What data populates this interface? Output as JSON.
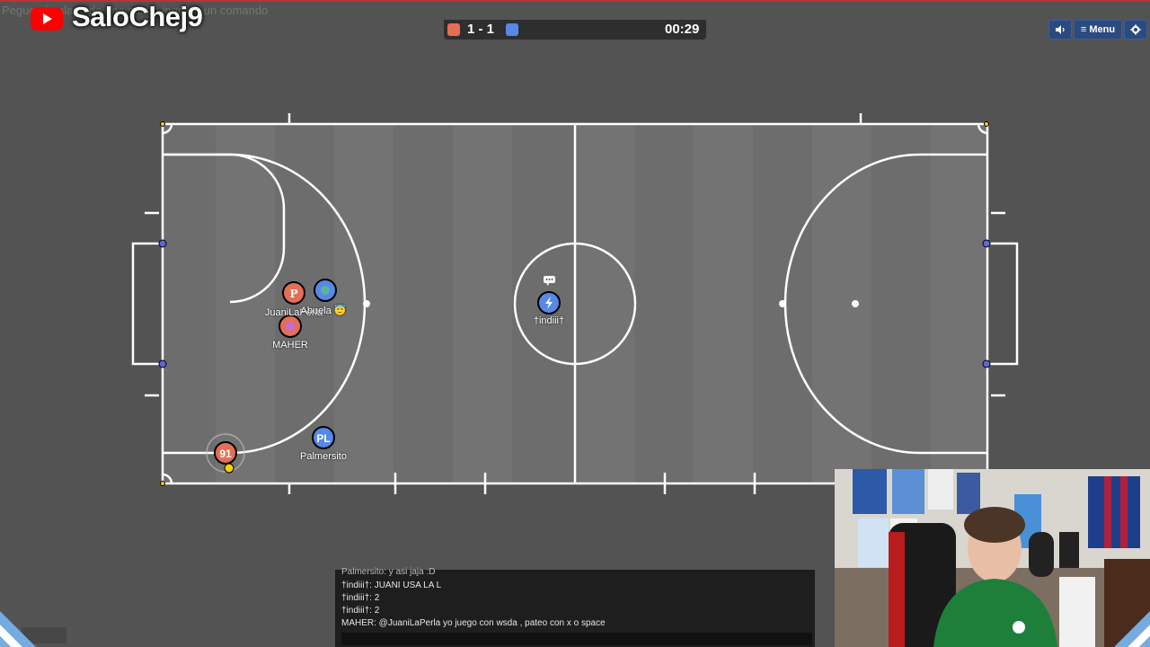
{
  "command_input": {
    "placeholder": "Pegue el enlace de una sala o ingrese un comando"
  },
  "channel": {
    "name": "SaloChej9",
    "icon": "youtube-play-icon"
  },
  "scoreboard": {
    "red_score": "1",
    "separator": "-",
    "blue_score": "1",
    "score_text": "1 - 1",
    "timer": "00:29",
    "red_color": "#e56e56",
    "blue_color": "#5689e5"
  },
  "top_buttons": {
    "sound_icon": "speaker-icon",
    "menu_label": "≡ Menu",
    "settings_icon": "gear-icon"
  },
  "players": [
    {
      "team": "red",
      "avatar": "P",
      "name": "JuaniLaPerla"
    },
    {
      "team": "blue",
      "avatar": "🌎",
      "name": "Abuela 😇"
    },
    {
      "team": "red",
      "avatar": "🌸",
      "name": "MAHER"
    },
    {
      "team": "blue",
      "avatar": "⚡",
      "name": "†indiii†",
      "chat_indicator": "💬"
    },
    {
      "team": "red",
      "avatar": "91",
      "name": ""
    },
    {
      "team": "blue",
      "avatar": "PL",
      "name": "Palmersito"
    }
  ],
  "chat": {
    "messages": [
      "Palmersito: y asi jaja :D",
      "†indiii†: JUANI USA LA L",
      "†indiii†: 2",
      "†indiii†: 2",
      "MAHER: @JuaniLaPerla yo juego con wsda , pateo con x o space"
    ]
  },
  "colors": {
    "team_red": "#e56e56",
    "team_blue": "#5689e5",
    "field": "#6d6d6d",
    "lines": "#ffffff"
  }
}
